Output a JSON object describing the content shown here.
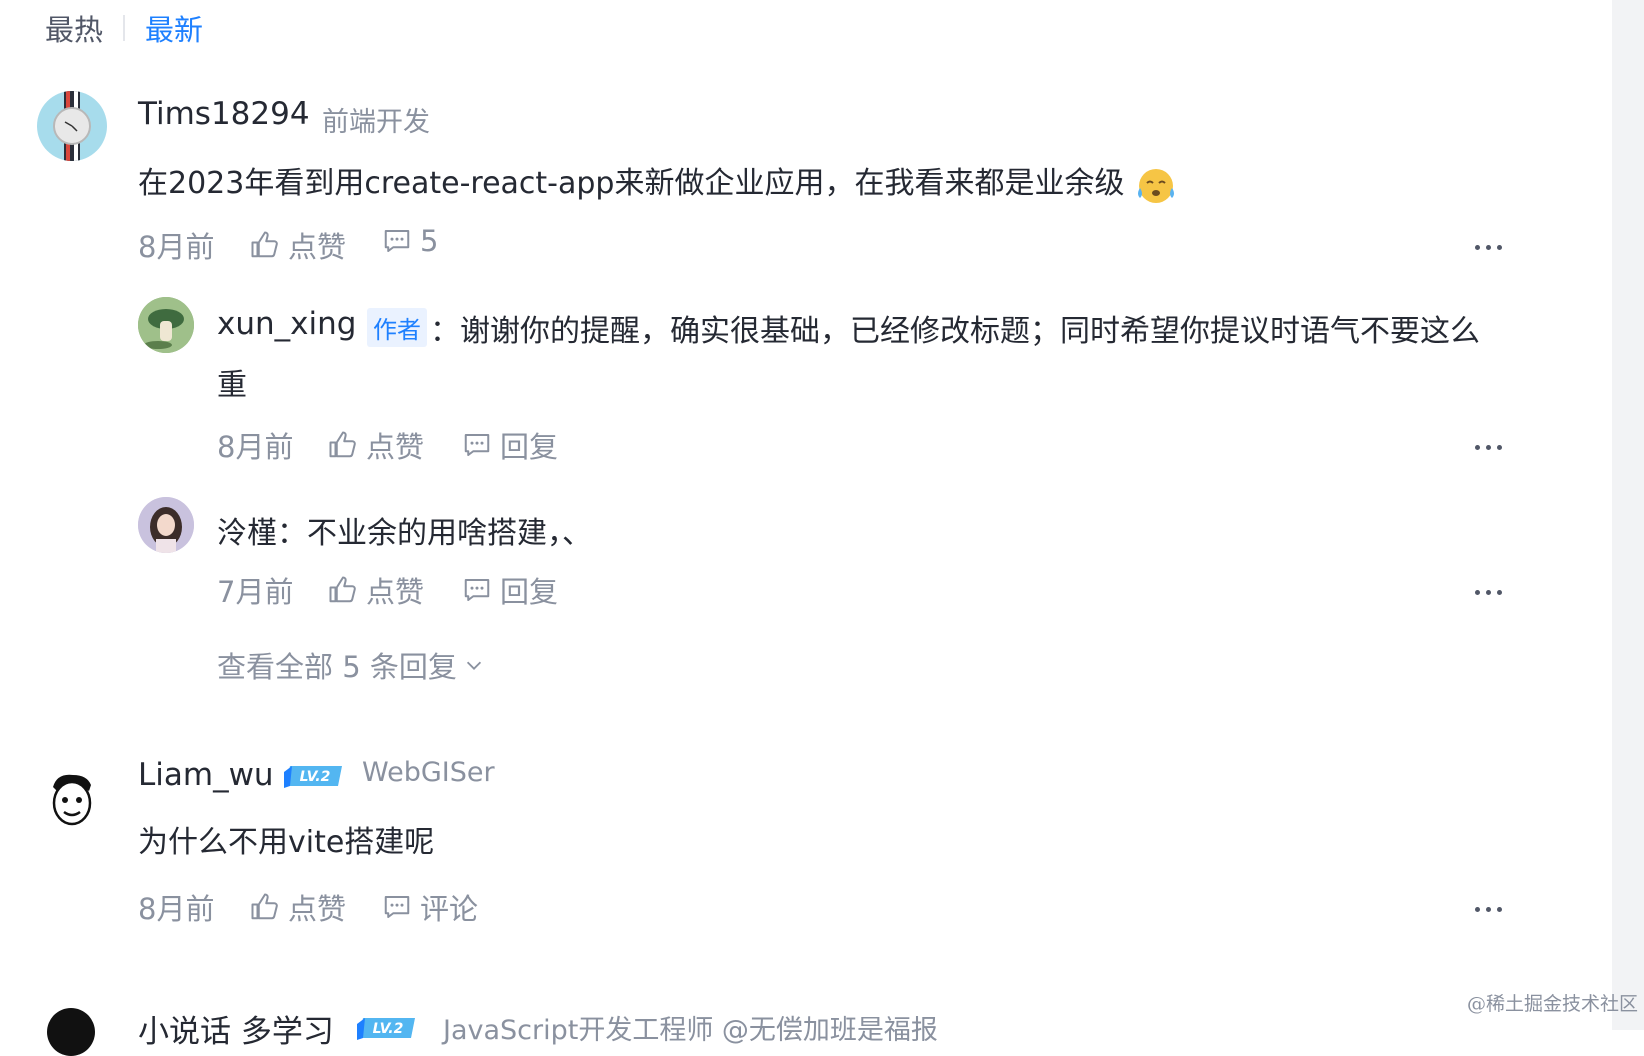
{
  "sort_tabs": {
    "hot": "最热",
    "new": "最新"
  },
  "comments": [
    {
      "username": "Tims18294",
      "job": "前端开发",
      "content": "在2023年看到用create-react-app来新做企业应用，在我看来都是业余级",
      "time": "8月前",
      "like_label": "点赞",
      "comment_count": "5",
      "replies": [
        {
          "username": "xun_xing",
          "author_tag": "作者",
          "content_line1": "：谢谢你的提醒，确实很基础，已经修改标题；同时希望你提议时语气不要这么",
          "content_line2": "重",
          "time": "8月前",
          "like_label": "点赞",
          "reply_label": "回复"
        },
        {
          "username": "泠槿",
          "content": "：不业余的用啥搭建，、",
          "time": "7月前",
          "like_label": "点赞",
          "reply_label": "回复"
        }
      ],
      "view_all": "查看全部 5 条回复"
    },
    {
      "username": "Liam_wu",
      "level": "LV.2",
      "job": "WebGISer",
      "content": "为什么不用vite搭建呢",
      "time": "8月前",
      "like_label": "点赞",
      "comment_label": "评论"
    },
    {
      "username": "小说话 多学习",
      "level": "LV.2",
      "job": "JavaScript开发工程师 @无偿加班是福报"
    }
  ],
  "watermark": "@稀土掘金技术社区",
  "colors": {
    "accent": "#1e80ff",
    "text": "#252933",
    "muted": "#8a919f"
  }
}
